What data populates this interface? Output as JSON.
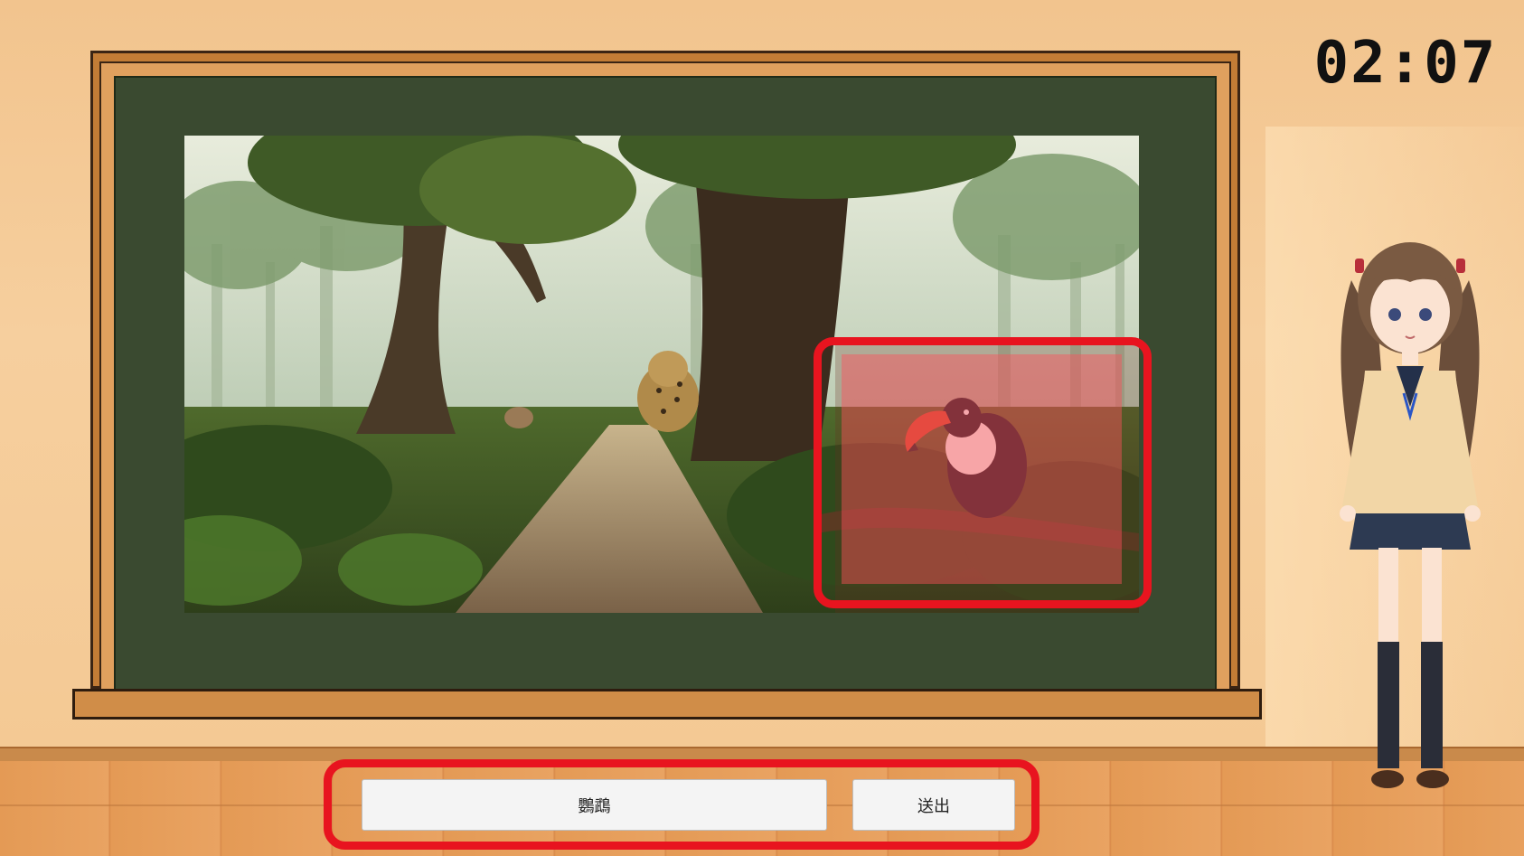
{
  "timer": {
    "text": "02:07"
  },
  "answer": {
    "value": "鸚鵡",
    "placeholder": ""
  },
  "submit": {
    "label": "送出"
  },
  "colors": {
    "highlight": "#e8141f",
    "board": "#3a4a30",
    "frame": "#c27c36",
    "wall": "#f4c994"
  },
  "icons": {
    "scene": "jungle-scene-image",
    "target": "toucan-bird",
    "mascot": "anime-schoolgirl-character"
  }
}
